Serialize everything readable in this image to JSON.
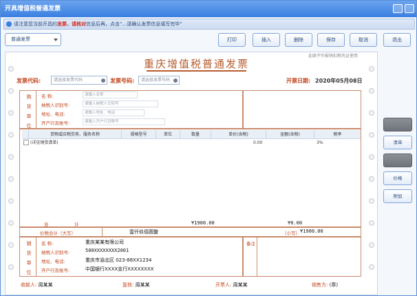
{
  "window": {
    "title": "开具增值税普通发票"
  },
  "hint": {
    "pre": "请注意您当前开具的",
    "red1": "发票",
    "mid": "，",
    "red2": "请核对",
    "post": "信息后再，点击“...请确认发票信息填写完毕”"
  },
  "toolbar": {
    "combo_value": "普通发票",
    "buttons": [
      "打印",
      "插入",
      "删除",
      "保存",
      "取消",
      "退出"
    ]
  },
  "invoice": {
    "title": "重庆增值税普通发票",
    "top_note": "此联不作报销扣税凭证使用",
    "code_label": "发票代码:",
    "code_value": "请选择发票代码",
    "number_label": "发票号码:",
    "number_value": "请选择发票号码",
    "date_label": "开票日期:",
    "date_value": "2020年05月08日",
    "buyer_vertical": [
      "购",
      "货",
      "单",
      "位"
    ],
    "buyer_rows": [
      {
        "label": "名     称:",
        "value": "请输入名称"
      },
      {
        "label": "纳税人识别号:",
        "value": "请输入纳税人识别号"
      },
      {
        "label": "地址、电话:",
        "value": "请输入地址、电话"
      },
      {
        "label": "开户行及账号:",
        "value": "请输入开户行及账号"
      }
    ],
    "grid_headers": [
      "货物或应税劳务、服务名称",
      "规格型号",
      "单位",
      "数量",
      "单价(含税)",
      "金额(含税)",
      "税率"
    ],
    "grid_row": {
      "name": "(详见销货清单)",
      "amount": "0.00",
      "rate": "3%"
    },
    "totals": {
      "label_heji1": "合",
      "label_heji2": "计",
      "amount": "¥1900.00",
      "tax": "¥0.00"
    },
    "capital_label": "价税合计（大写）",
    "capital_value": "壹仟玖佰圆整",
    "capital_small_label": "（小写）",
    "capital_small_value": "¥1900.00",
    "seller_vertical": [
      "销",
      "货",
      "单",
      "位"
    ],
    "seller_rows": [
      {
        "label": "名     称:",
        "value": "重庆某某有限公司"
      },
      {
        "label": "纳税人识别号:",
        "value": "500XXXXXXXX2001"
      },
      {
        "label": "地址、电话:",
        "value": "重庆市渝北区 023-88XX1234"
      },
      {
        "label": "开户行及账号:",
        "value": "中国银行XXXX支行XXXXXXXX"
      }
    ],
    "remark_label": "备注",
    "footer": [
      {
        "label": "收款人:",
        "value": "周某某"
      },
      {
        "label": "复核:",
        "value": "周某某"
      },
      {
        "label": "开票人:",
        "value": "周某某"
      },
      {
        "label": "销售方:",
        "value": "(章)"
      }
    ]
  },
  "side_buttons": [
    "",
    "清单",
    "",
    "价格",
    "附加"
  ]
}
